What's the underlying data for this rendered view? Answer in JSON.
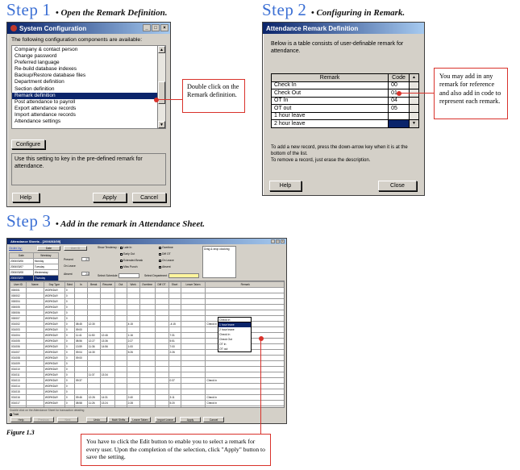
{
  "step1": {
    "word": "Step",
    "number": "1",
    "desc": "• Open the Remark Definition.",
    "window": {
      "title": "System Configuration",
      "intro": "The following configuration components are available:",
      "items": [
        "Company & contact person",
        "Change password",
        "Preferred language",
        "Re-build database indexes",
        "Backup/Restore database files",
        "Department definition",
        "Section definition",
        "Remark definition",
        "Post attendance to payroll",
        "Export attendance records",
        "Import attendance records",
        "Attendance settings"
      ],
      "selected_index": 7,
      "configure_label": "Configure",
      "description": "Use this setting to key in the pre-defined remark for attendance.",
      "help_label": "Help",
      "apply_label": "Apply",
      "cancel_label": "Cancel"
    },
    "callout": "Double click on the Remark definition."
  },
  "step2": {
    "word": "Step",
    "number": "2",
    "desc": "• Configuring in Remark.",
    "window": {
      "title": "Attendance Remark Definition",
      "intro": "Below is a table consists of user-definable remark for attendance.",
      "col_remark": "Remark",
      "col_code": "Code",
      "rows": [
        {
          "remark": "Check In",
          "code": "00"
        },
        {
          "remark": "Check Out",
          "code": "01"
        },
        {
          "remark": "OT In",
          "code": "04"
        },
        {
          "remark": "OT out",
          "code": "05"
        },
        {
          "remark": "1 hour leave",
          "code": ""
        },
        {
          "remark": "2 hour leave",
          "code": ""
        }
      ],
      "note1": "To add a new record, press the down-arrow key when it is at the bottom of the list.",
      "note2": "To remove a record, just erase the description.",
      "help_label": "Help",
      "close_label": "Close"
    },
    "callout": "You may add in any remark for reference and also add in code to represent each remark."
  },
  "step3": {
    "word": "Step",
    "number": "3",
    "desc": "• Add in the remark in Attendance Sheet.",
    "window": {
      "title": "Attendance Sheets - [2006/03/09]",
      "order_by": "Order by:",
      "date_btn": "Date",
      "user_btn": "User ID",
      "mini_headers": [
        "Date",
        "Weekday"
      ],
      "mini_rows": [
        [
          "2006/03/06",
          "Monday"
        ],
        [
          "2006/03/07",
          "Tuesday"
        ],
        [
          "2006/03/08",
          "Wednesday"
        ],
        [
          "2006/03/09",
          "Thursday"
        ]
      ],
      "present_label": "Present",
      "present_val": "27",
      "onleave_label": "On Leave",
      "absent_label": "Absent",
      "absent_val": "24",
      "tendency_label": "Show Tendency :",
      "checks": [
        "Late In",
        "Early Out",
        "Extended Break",
        "Miss Punch",
        "Overtime",
        "Diff OT",
        "On Leave",
        "Absent"
      ],
      "dragdrop": "Drag & drop clocking",
      "select_schedule": "Select Schedule :",
      "select_department": "Select Department :",
      "headers": [
        "User ID",
        "Name",
        "Day Type",
        "Schd",
        "In",
        "Break",
        "Resume",
        "Out",
        "Work",
        "Overtime",
        "Diff OT",
        "Short",
        "Leave Taken",
        "Remark"
      ],
      "rows": [
        [
          "000001",
          "",
          "WORKDAY",
          "0",
          "",
          "",
          "",
          "",
          "",
          "",
          "",
          "",
          "",
          ""
        ],
        [
          "000002",
          "",
          "WORKDAY",
          "0",
          "",
          "",
          "",
          "",
          "",
          "",
          "",
          "",
          "",
          ""
        ],
        [
          "000004",
          "",
          "WORKDAY",
          "0",
          "",
          "",
          "",
          "",
          "",
          "",
          "",
          "",
          "",
          ""
        ],
        [
          "000005",
          "",
          "WORKDAY",
          "0",
          "",
          "",
          "",
          "",
          "",
          "",
          "",
          "",
          "",
          ""
        ],
        [
          "000006",
          "",
          "WORKDAY",
          "0",
          "",
          "",
          "",
          "",
          "",
          "",
          "",
          "",
          "",
          ""
        ],
        [
          "000007",
          "",
          "WORKDAY",
          "0",
          "",
          "",
          "",
          "",
          "",
          "",
          "",
          "",
          "",
          ""
        ],
        [
          "001002",
          "",
          "WORKDAY",
          "0",
          "08:45",
          "12:30",
          "",
          "",
          "4:15",
          "",
          "",
          "-4:15",
          "",
          "Check In"
        ],
        [
          "001003",
          "",
          "WORKDAY",
          "0",
          "09:00",
          "",
          "",
          "",
          "",
          "",
          "",
          "",
          "",
          ""
        ],
        [
          "001004",
          "",
          "WORKDAY",
          "0",
          "11:41",
          "11:50",
          "12:46",
          "",
          "1:16",
          "",
          "",
          "7:31",
          "",
          ""
        ],
        [
          "001005",
          "",
          "WORKDAY",
          "0",
          "08:56",
          "12:27",
          "13:36",
          "",
          "2:27",
          "",
          "",
          "5:51",
          "",
          ""
        ],
        [
          "001006",
          "",
          "WORKDAY",
          "0",
          "13:59",
          "11:36",
          "14:56",
          "",
          "1:00",
          "",
          "",
          "7:00",
          "",
          ""
        ],
        [
          "001007",
          "",
          "WORKDAY",
          "0",
          "09:04",
          "14:30",
          "",
          "",
          "5:26",
          "",
          "",
          "2:26",
          "",
          ""
        ],
        [
          "001008",
          "",
          "WORKDAY",
          "0",
          "09:00",
          "",
          "",
          "",
          "",
          "",
          "",
          "",
          "",
          ""
        ],
        [
          "001009",
          "",
          "WORKDAY",
          "0",
          "",
          "",
          "",
          "",
          "",
          "",
          "",
          "",
          "",
          ""
        ],
        [
          "001010",
          "",
          "WORKDAY",
          "0",
          "",
          "",
          "",
          "",
          "",
          "",
          "",
          "",
          "",
          ""
        ],
        [
          "001011",
          "",
          "WORKDAY",
          "0",
          "",
          "11:37",
          "13:34",
          "",
          "",
          "",
          "",
          "",
          "",
          ""
        ],
        [
          "001013",
          "",
          "WORKDAY",
          "0",
          "09:37",
          "",
          "",
          "",
          "",
          "",
          "",
          "0:37",
          "",
          "Check In"
        ],
        [
          "001014",
          "",
          "WORKDAY",
          "0",
          "",
          "",
          "",
          "",
          "",
          "",
          "",
          "",
          "",
          ""
        ],
        [
          "001015",
          "",
          "WORKDAY",
          "0",
          "",
          "",
          "",
          "",
          "",
          "",
          "",
          "",
          "",
          ""
        ],
        [
          "001016",
          "",
          "WORKDAY",
          "0",
          "09:46",
          "12:26",
          "14:31",
          "",
          "2:40",
          "",
          "",
          "3:11",
          "",
          "Check In"
        ],
        [
          "001017",
          "",
          "WORKDAY",
          "0",
          "08:58",
          "11:26",
          "13:24",
          "",
          "2:28",
          "",
          "",
          "5:20",
          "",
          "Check In"
        ],
        [
          "001018",
          "",
          "WORKDAY",
          "0",
          "08:51",
          "12:11",
          "13:46",
          "",
          "4:02",
          "",
          "",
          "4:57",
          "",
          "Check In"
        ],
        [
          "001019",
          "",
          "WORKDAY",
          "0",
          "",
          "13:56",
          "",
          "",
          "",
          "",
          "",
          "",
          "",
          ""
        ],
        [
          "001100",
          "",
          "WORKDAY",
          "0",
          "08:58",
          "",
          "",
          "",
          "",
          "",
          "",
          "",
          "",
          ""
        ]
      ],
      "dropdown": [
        "Check In",
        "1 hour leave",
        "2 hour leave",
        "Check In",
        "Check Out",
        "OT In",
        "OT out"
      ],
      "footer_status": "Double click on the Attendance Sheet for transaction detailing",
      "total_label": "Total",
      "buttons": [
        "Help",
        "Previous",
        "Next",
        "Undo",
        "Multi Shifts",
        "Leave Taken",
        "Import Leave",
        "Apply",
        "Cancel"
      ]
    },
    "callout": "You have to click the Edit button to enable you to select a remark for every user. Upon the completion of the selection, click \"Apply\" button to save the setting."
  },
  "figure_label": "Figure 1.3"
}
